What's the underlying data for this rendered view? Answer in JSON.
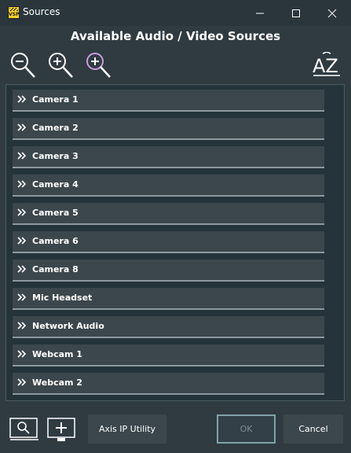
{
  "window": {
    "title": "Sources",
    "logo_text": "VSP"
  },
  "heading": "Available Audio / Video Sources",
  "toolbar": {
    "zoom_out_icon": "zoom-out-icon",
    "zoom_in_icon": "zoom-in-icon",
    "zoom_reset_icon": "zoom-reset-icon",
    "sort_label": "AZ"
  },
  "sources": [
    {
      "label": "Camera 1"
    },
    {
      "label": "Camera 2"
    },
    {
      "label": "Camera 3"
    },
    {
      "label": "Camera 4"
    },
    {
      "label": "Camera 5"
    },
    {
      "label": "Camera 6"
    },
    {
      "label": "Camera 8"
    },
    {
      "label": "Mic Headset"
    },
    {
      "label": "Network Audio"
    },
    {
      "label": "Webcam 1"
    },
    {
      "label": "Webcam 2"
    }
  ],
  "buttons": {
    "axis": "Axis IP Utility",
    "ok": "OK",
    "cancel": "Cancel"
  },
  "colors": {
    "background": "#2f3b41",
    "item": "#3b474d",
    "ok_border": "#7fa2a8",
    "zoom_reset_accent": "#c99be0"
  }
}
